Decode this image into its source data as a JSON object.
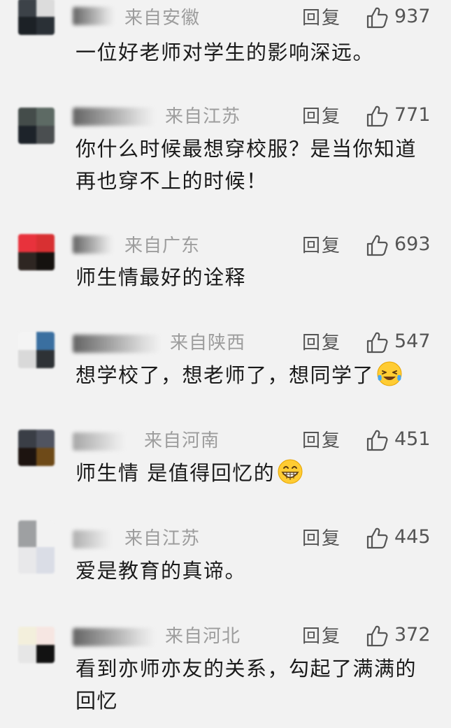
{
  "reply_label": "回复",
  "comments": [
    {
      "location": "来自安徽",
      "likes": "937",
      "text": "一位好老师对学生的影响深远。",
      "avatar_colors": [
        "#3c4248",
        "#dcdcdc",
        "#1c2126",
        "#2a3036"
      ]
    },
    {
      "location": "来自江苏",
      "likes": "771",
      "text": "你什么时候最想穿校服？是当你知道再也穿不上的时候！",
      "avatar_colors": [
        "#444c4a",
        "#5d6a64",
        "#1d232a",
        "#4a4e50"
      ]
    },
    {
      "location": "来自广东",
      "likes": "693",
      "text": "师生情最好的诠释",
      "avatar_colors": [
        "#e8323c",
        "#d83032",
        "#2e2622",
        "#15120f"
      ]
    },
    {
      "location": "来自陕西",
      "likes": "547",
      "text": "想学校了，想老师了，想同学了",
      "emoji": "laugh-cry-icon",
      "avatar_colors": [
        "#f4f4f4",
        "#3a6fa0",
        "#d9d9d9",
        "#2e3236"
      ]
    },
    {
      "location": "来自河南",
      "likes": "451",
      "text": "师生情 是值得回忆的",
      "emoji": "grin-icon",
      "avatar_colors": [
        "#3a3e46",
        "#505460",
        "#1d1410",
        "#6e4a18"
      ]
    },
    {
      "location": "来自江苏",
      "likes": "445",
      "text": "爱是教育的真谛。",
      "avatar_colors": [
        "#9ea0a2",
        "#f2f2f2",
        "#e8e8ea",
        "#dadde6"
      ]
    },
    {
      "location": "来自河北",
      "likes": "372",
      "text": "看到亦师亦友的关系，勾起了满满的回忆",
      "avatar_colors": [
        "#f3efdc",
        "#f6e6e2",
        "#e6e6e6",
        "#121212"
      ]
    }
  ]
}
